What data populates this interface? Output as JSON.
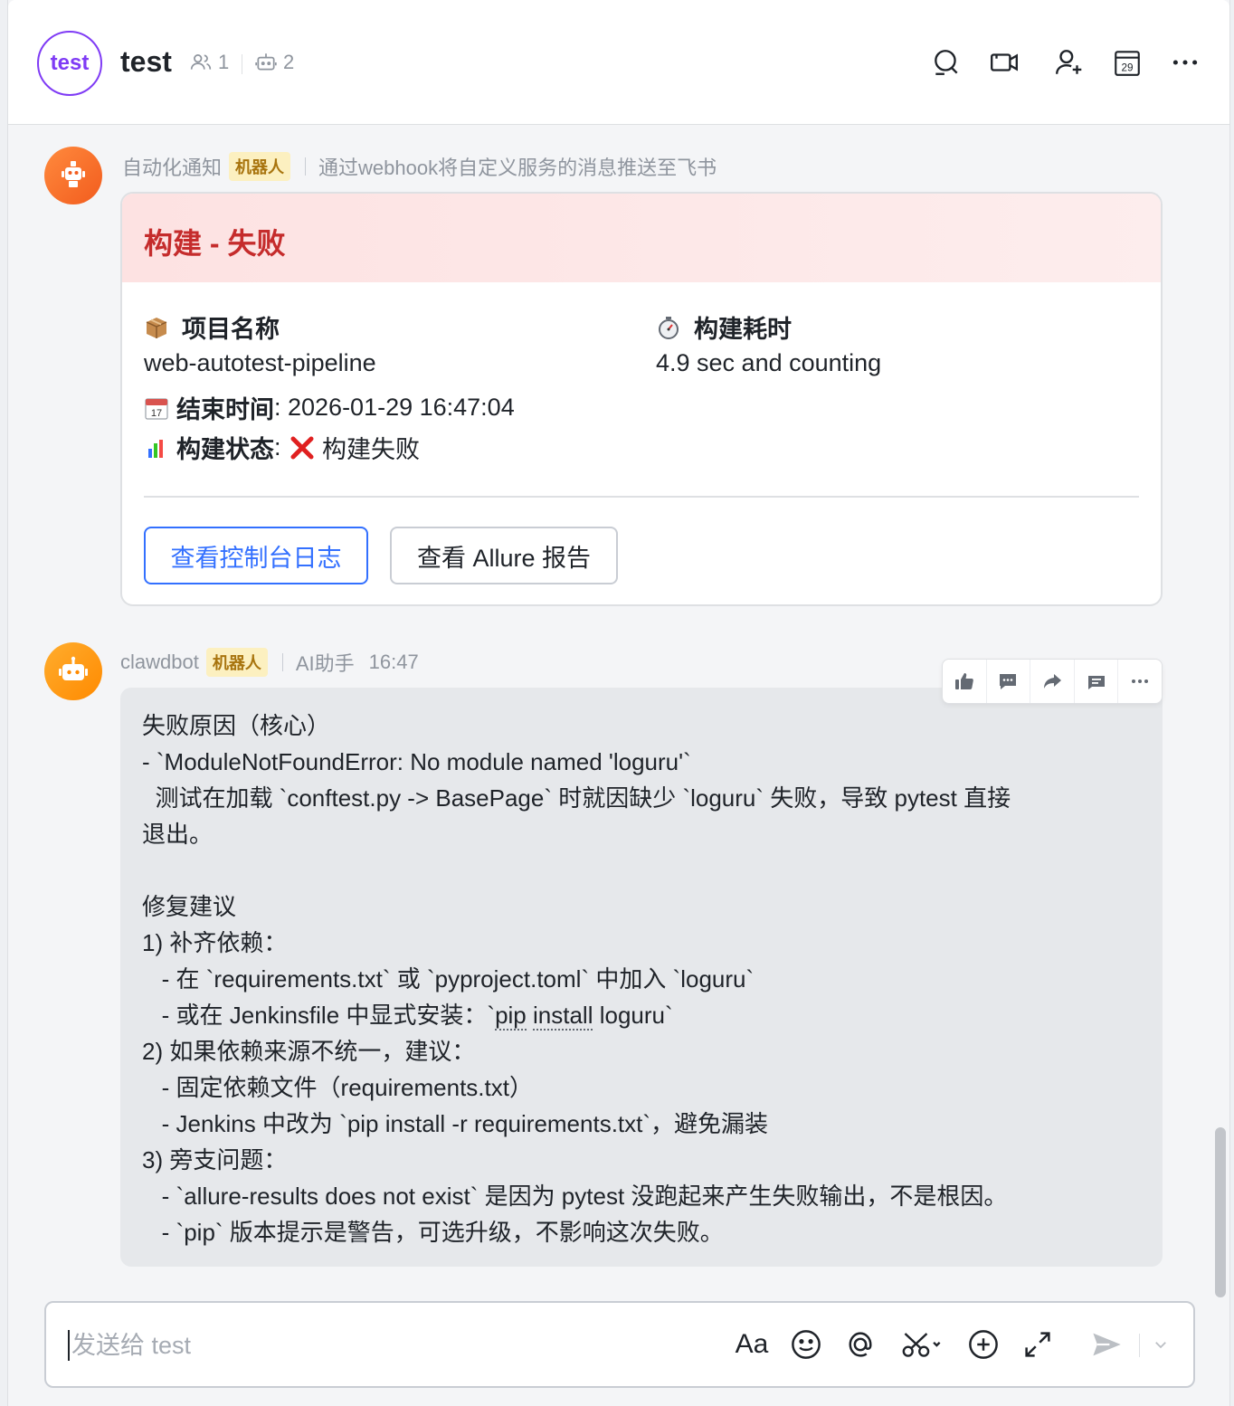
{
  "header": {
    "avatar_text": "test",
    "title": "test",
    "member_count": "1",
    "bot_count": "2",
    "icons": [
      "search-icon",
      "video-call-icon",
      "add-member-icon",
      "calendar-icon",
      "more-icon"
    ],
    "calendar_day": "29"
  },
  "message1": {
    "sender": "自动化通知",
    "badge": "机器人",
    "description": "通过webhook将自定义服务的消息推送至飞书",
    "card": {
      "title": "构建 - 失败",
      "title_color": "#c52c2c",
      "project_label": "项目名称",
      "project_value": "web-autotest-pipeline",
      "duration_label": "构建耗时",
      "duration_value": "4.9 sec and counting",
      "end_time_label": "结束时间",
      "end_time_value": ": 2026-01-29 16:47:04",
      "status_label": "构建状态",
      "status_sep": ": ",
      "status_value": "构建失败",
      "calendar_emoji_day": "17",
      "button_console": "查看控制台日志",
      "button_allure": "查看 Allure 报告"
    }
  },
  "message2": {
    "sender": "clawdbot",
    "badge": "机器人",
    "description": "AI助手",
    "time": "16:47",
    "lines": [
      "失败原因（核心）",
      "- `ModuleNotFoundError: No module named 'loguru'`",
      "  测试在加载 `conftest.py -> BasePage` 时就因缺少 `loguru` 失败，导致 pytest 直接",
      "退出。",
      "",
      "修复建议",
      "1) 补齐依赖：",
      "   - 在 `requirements.txt` 或 `pyproject.toml` 中加入 `loguru`",
      "   - 或在 Jenkinsfile 中显式安装：`pip install loguru`",
      "2) 如果依赖来源不统一，建议：",
      "   - 固定依赖文件（requirements.txt）",
      "   - Jenkins 中改为 `pip install -r requirements.txt`，避免漏装",
      "3) 旁支问题：",
      "   - `allure-results does not exist` 是因为 pytest 没跑起来产生失败输出，不是根因。",
      "   - `pip` 版本提示是警告，可选升级，不影响这次失败。"
    ]
  },
  "composer": {
    "placeholder": "发送给 test",
    "format_label": "Aa"
  },
  "colors": {
    "accent": "#3370ff",
    "bot_badge_bg": "#fcf0c0",
    "error": "#c52c2c",
    "group_avatar": "#7f3bf5"
  }
}
